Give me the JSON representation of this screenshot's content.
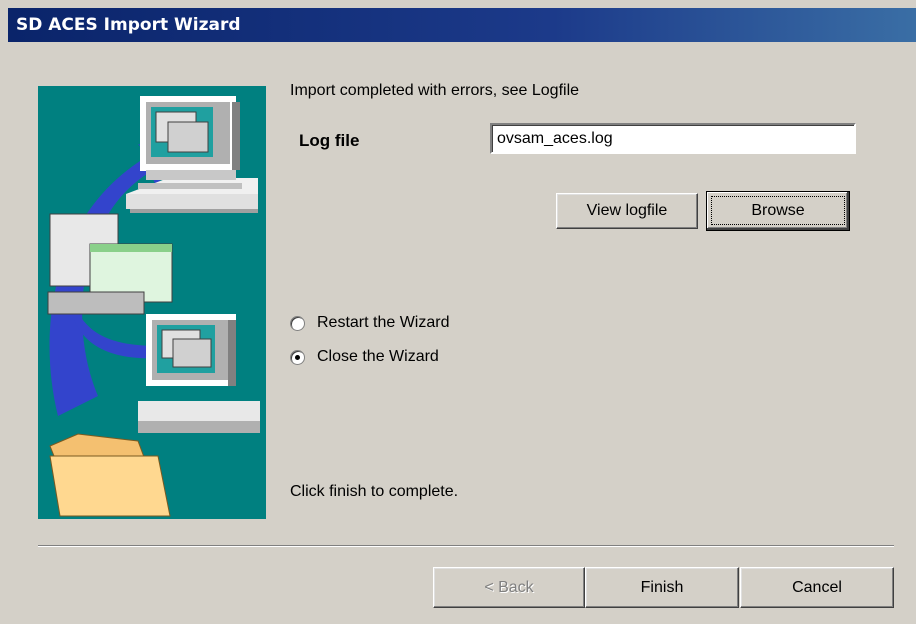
{
  "window": {
    "title": "SD ACES Import Wizard"
  },
  "status": {
    "message": "Import completed with errors, see Logfile"
  },
  "logfile": {
    "label": "Log file",
    "value": "ovsam_aces.log"
  },
  "buttons": {
    "view_logfile": "View logfile",
    "browse": "Browse",
    "back": "< Back",
    "finish": "Finish",
    "cancel": "Cancel"
  },
  "options": [
    {
      "label": "Restart the Wizard",
      "selected": false
    },
    {
      "label": "Close the Wizard",
      "selected": true
    }
  ],
  "footer_hint": "Click finish to complete.",
  "colors": {
    "title_bar": "#0a246a",
    "image_background": "#008080",
    "dialog": "#d4d0c8"
  }
}
